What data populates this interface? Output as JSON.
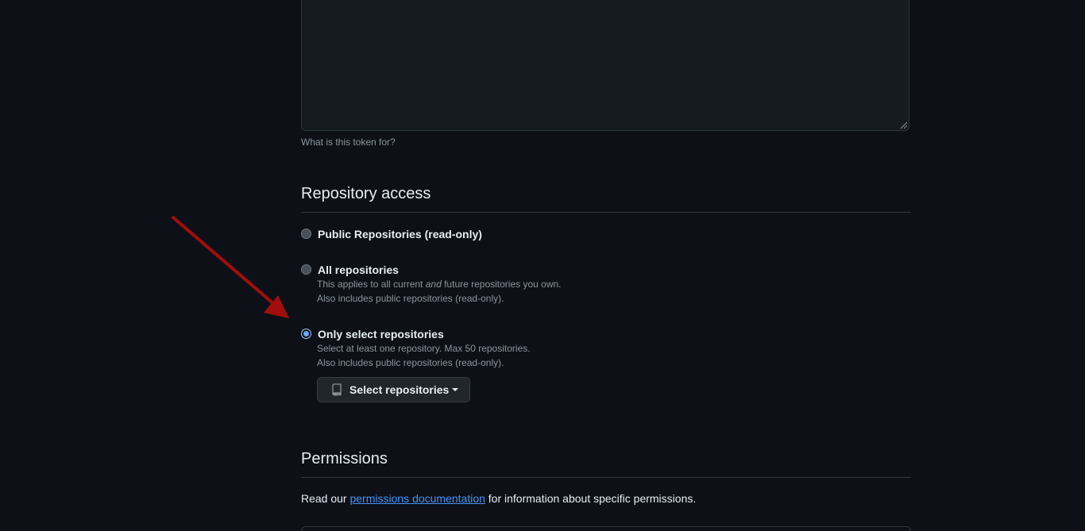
{
  "token_description": {
    "value": "",
    "hint": "What is this token for?"
  },
  "repository_access": {
    "title": "Repository access",
    "options": [
      {
        "label": "Public Repositories (read-only)",
        "checked": false
      },
      {
        "label": "All repositories",
        "checked": false,
        "note_before": "This applies to all current ",
        "note_em": "and",
        "note_after": " future repositories you own.",
        "note_line2": "Also includes public repositories (read-only)."
      },
      {
        "label": "Only select repositories",
        "checked": true,
        "note_line1": "Select at least one repository. Max 50 repositories.",
        "note_line2": "Also includes public repositories (read-only)."
      }
    ],
    "select_button": {
      "icon": "repo-icon",
      "label": "Select repositories"
    }
  },
  "permissions": {
    "title": "Permissions",
    "text_before": "Read our ",
    "link_text": "permissions documentation",
    "text_after": " for information about specific permissions."
  },
  "colors": {
    "background": "#0d1117",
    "link": "#4493f8",
    "annotation_arrow": "#a30d0d",
    "radio_checked": "#6ea8fe"
  }
}
